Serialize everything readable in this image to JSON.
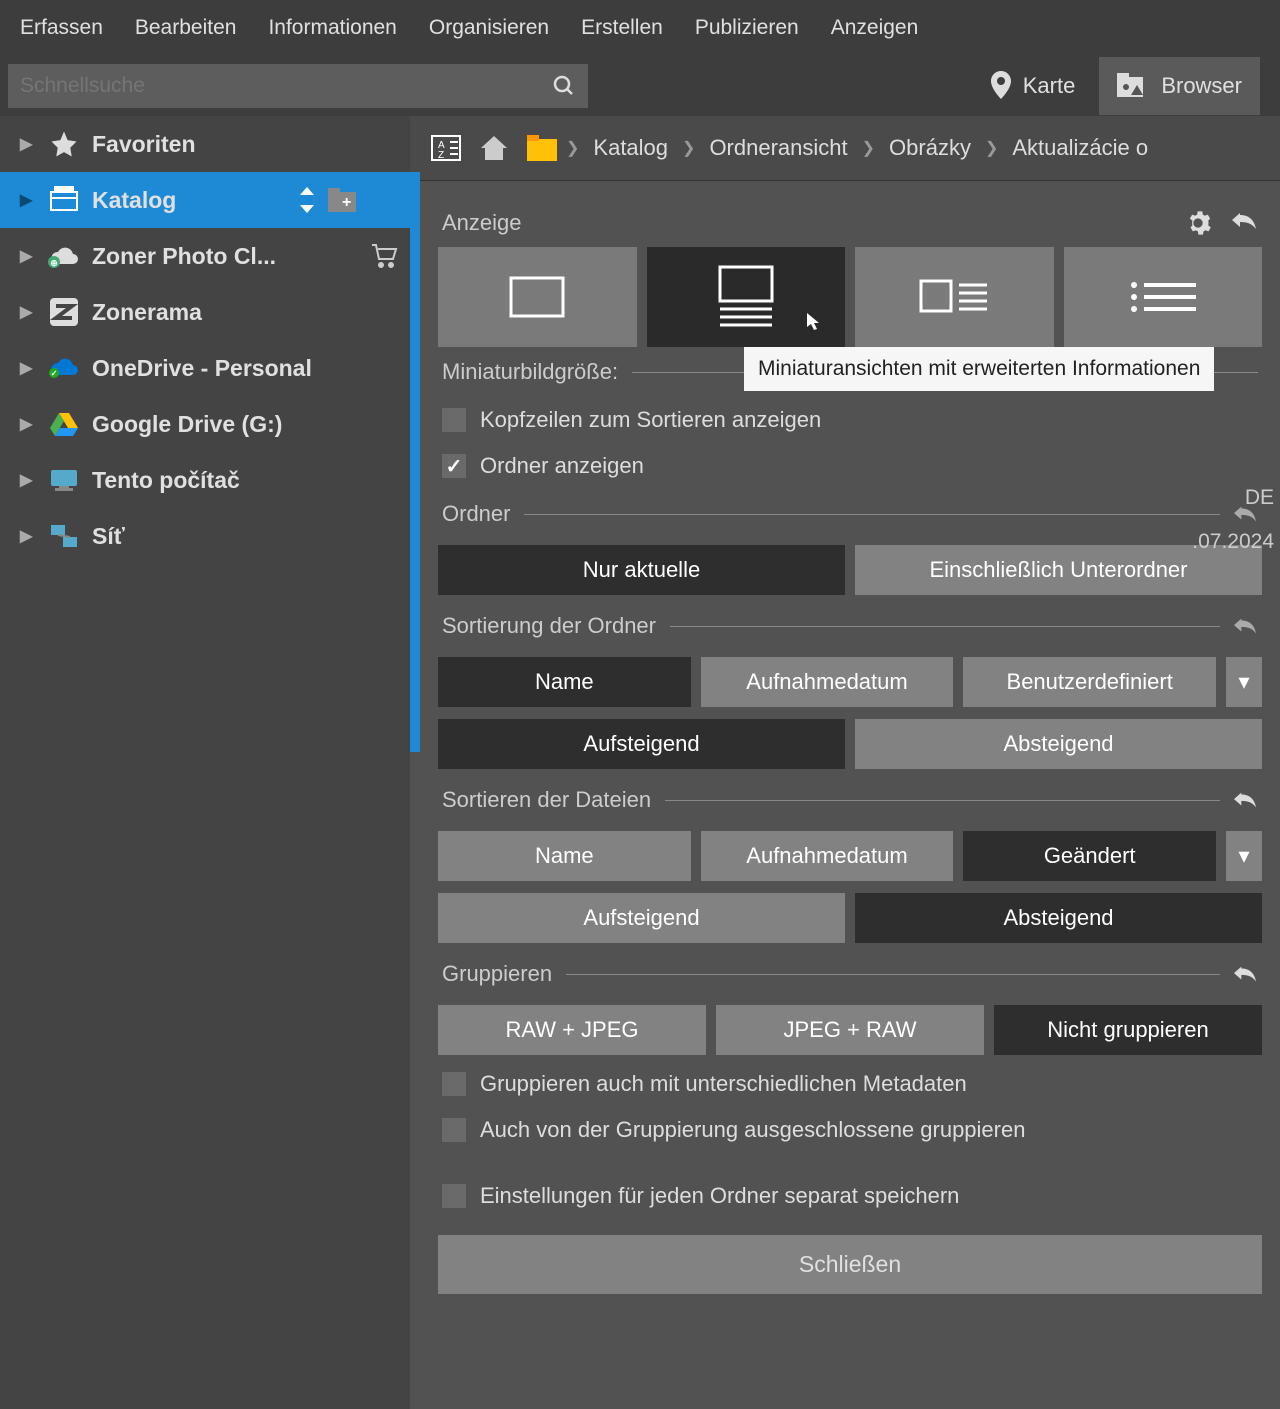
{
  "menubar": [
    "Erfassen",
    "Bearbeiten",
    "Informationen",
    "Organisieren",
    "Erstellen",
    "Publizieren",
    "Anzeigen"
  ],
  "search": {
    "placeholder": "Schnellsuche"
  },
  "topRight": {
    "karte": "Karte",
    "browser": "Browser"
  },
  "sidebar": {
    "items": [
      {
        "label": "Favoriten",
        "icon": "star"
      },
      {
        "label": "Katalog",
        "icon": "catalog",
        "selected": true
      },
      {
        "label": "Zoner Photo Cl...",
        "icon": "cloud-globe",
        "trail": "cart"
      },
      {
        "label": "Zonerama",
        "icon": "zonerama"
      },
      {
        "label": "OneDrive - Personal",
        "icon": "onedrive"
      },
      {
        "label": "Google Drive (G:)",
        "icon": "gdrive"
      },
      {
        "label": "Tento počítač",
        "icon": "computer"
      },
      {
        "label": "Síť",
        "icon": "network"
      }
    ]
  },
  "breadcrumb": {
    "items": [
      "Katalog",
      "Ordneransicht",
      "Obrázky",
      "Aktualizácie o"
    ]
  },
  "panel": {
    "title": "Anzeige",
    "tooltip": "Miniaturansichten mit erweiterten Informationen",
    "thumbSizeLabel": "Miniaturbildgröße:",
    "checkboxes": {
      "showHeaders": "Kopfzeilen zum Sortieren anzeigen",
      "showFolders": "Ordner anzeigen",
      "groupMeta": "Gruppieren auch mit unterschiedlichen Metadaten",
      "groupExcluded": "Auch von der Gruppierung ausgeschlossene gruppieren",
      "perFolder": "Einstellungen für jeden Ordner separat speichern"
    },
    "sections": {
      "ordner": "Ordner",
      "sortOrdner": "Sortierung der Ordner",
      "sortDateien": "Sortieren der Dateien",
      "gruppieren": "Gruppieren"
    },
    "buttons": {
      "nurAktuelle": "Nur aktuelle",
      "einschlUnter": "Einschließlich Unterordner",
      "name": "Name",
      "aufnahmedatum": "Aufnahmedatum",
      "benutzerdefiniert": "Benutzerdefiniert",
      "aufsteigend": "Aufsteigend",
      "absteigend": "Absteigend",
      "geaendert": "Geändert",
      "rawJpeg": "RAW + JPEG",
      "jpegRaw": "JPEG + RAW",
      "nichtGruppieren": "Nicht gruppieren",
      "schliessen": "Schließen"
    }
  },
  "sideInfo": {
    "lang": "DE",
    "date": ".07.2024"
  }
}
